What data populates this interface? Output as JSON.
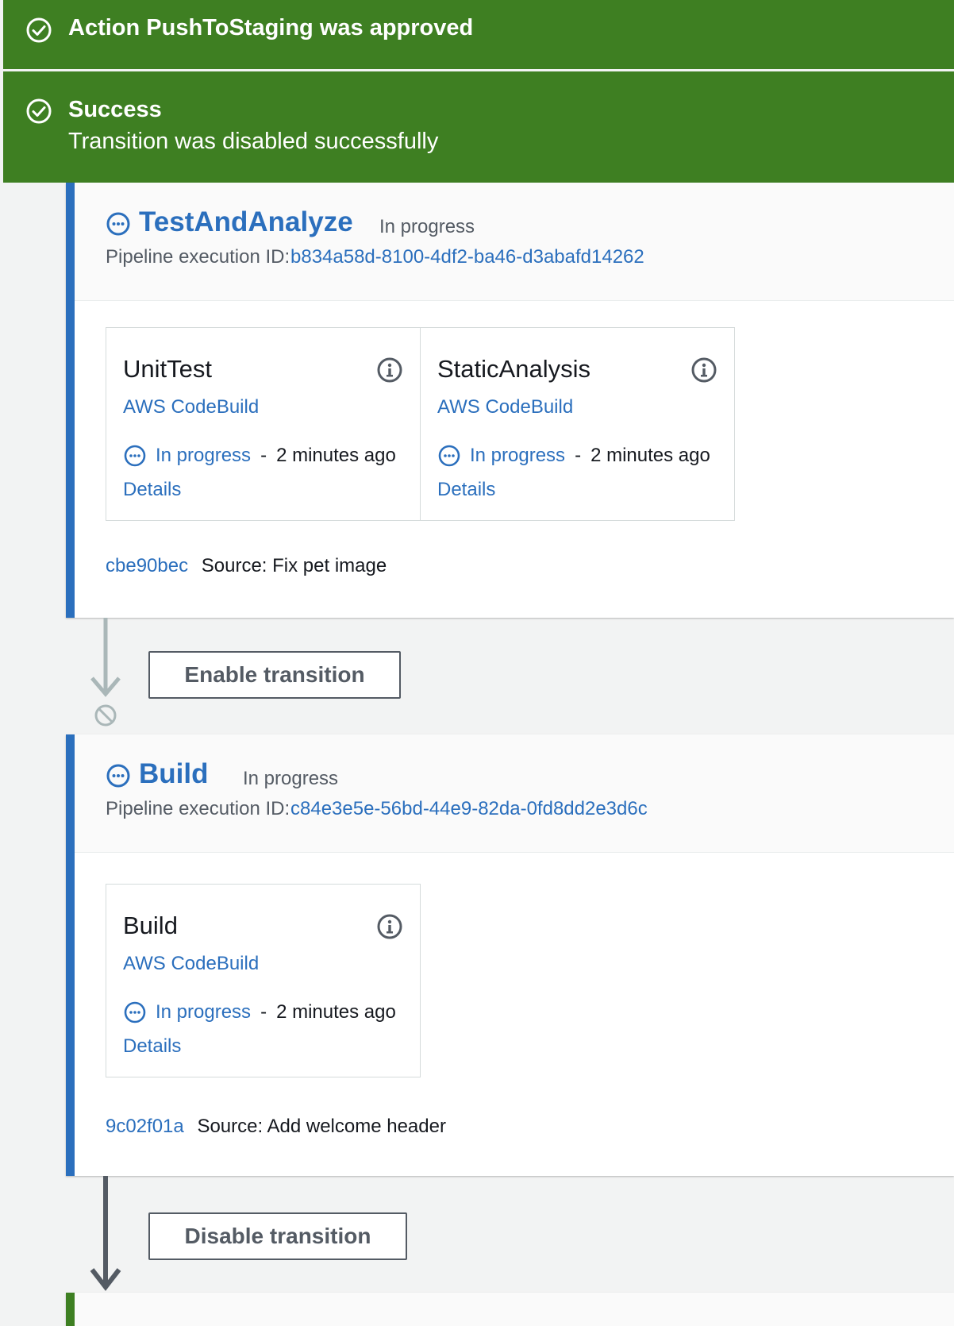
{
  "flashbar": {
    "approved": {
      "message": "Action PushToStaging was approved",
      "icon": "check-circle-icon"
    },
    "success": {
      "title": "Success",
      "message": "Transition was disabled successfully",
      "icon": "check-circle-icon"
    }
  },
  "stages": [
    {
      "name": "TestAndAnalyze",
      "status": "In progress",
      "execution_label": "Pipeline execution ID:",
      "execution_id": "b834a58d-8100-4df2-ba46-d3abafd14262",
      "actions": [
        {
          "name": "UnitTest",
          "provider": "AWS CodeBuild",
          "status": "In progress",
          "separator": "-",
          "time": "2 minutes ago",
          "details": "Details"
        },
        {
          "name": "StaticAnalysis",
          "provider": "AWS CodeBuild",
          "status": "In progress",
          "separator": "-",
          "time": "2 minutes ago",
          "details": "Details"
        }
      ],
      "source_commit": "cbe90bec",
      "source_message": "Source: Fix pet image"
    },
    {
      "name": "Build",
      "status": "In progress",
      "execution_label": "Pipeline execution ID:",
      "execution_id": "c84e3e5e-56bd-44e9-82da-0fd8dd2e3d6c",
      "actions": [
        {
          "name": "Build",
          "provider": "AWS CodeBuild",
          "status": "In progress",
          "separator": "-",
          "time": "2 minutes ago",
          "details": "Details"
        }
      ],
      "source_commit": "9c02f01a",
      "source_message": "Source: Add welcome header"
    }
  ],
  "transitions": [
    {
      "button_label": "Enable transition",
      "state": "disabled"
    },
    {
      "button_label": "Disable transition",
      "state": "enabled"
    }
  ],
  "colors": {
    "success_green": "#3e7f22",
    "link_blue": "#2b6fbd",
    "in_progress_blue": "#2b6fbd",
    "disabled_gray": "#aab7b8",
    "enabled_arrow": "#545b64"
  }
}
